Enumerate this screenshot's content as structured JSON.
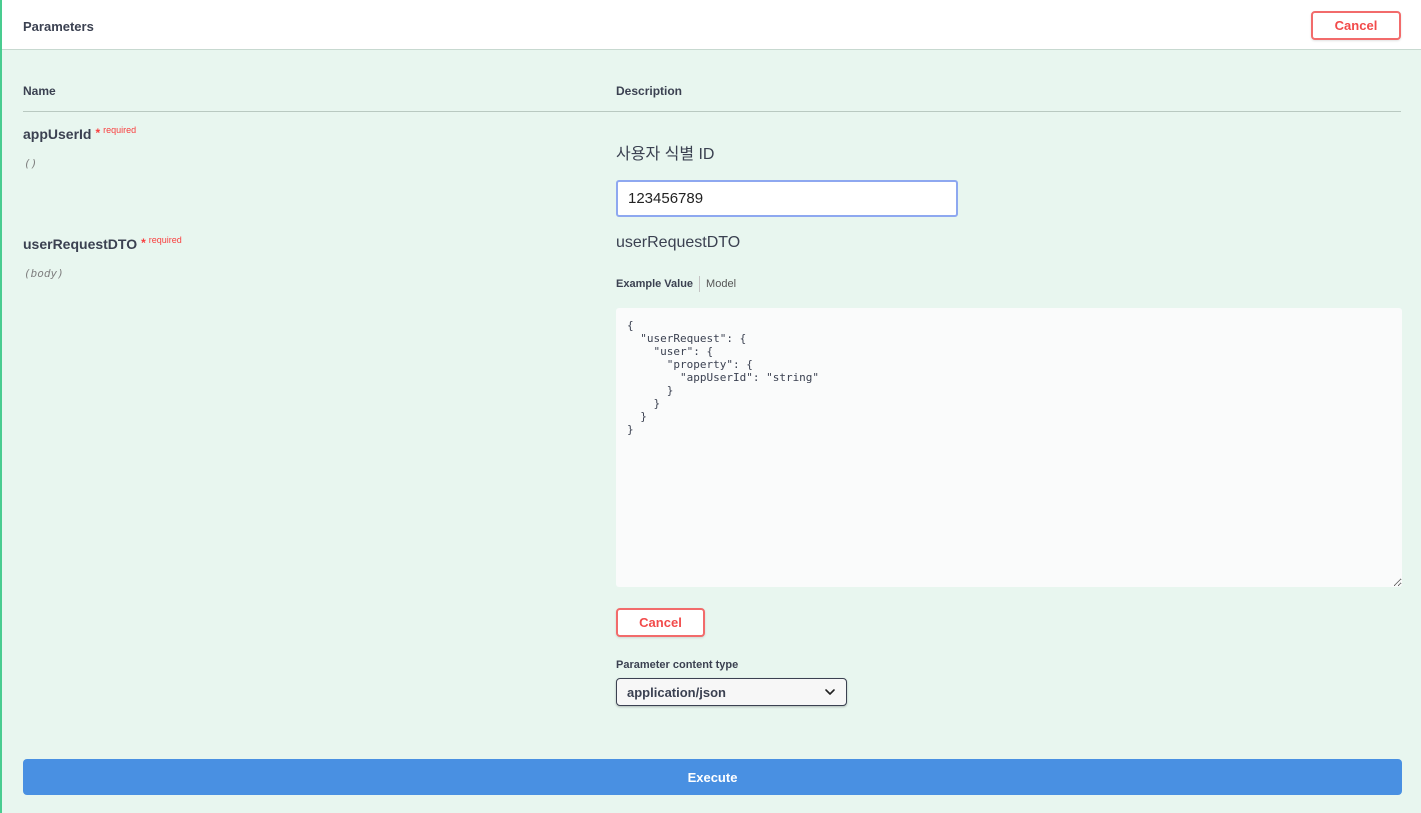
{
  "header": {
    "title": "Parameters",
    "cancel_label": "Cancel"
  },
  "columns": {
    "name": "Name",
    "description": "Description"
  },
  "params": [
    {
      "name": "appUserId",
      "star": "*",
      "required": "required",
      "in": "()",
      "description": "사용자 식별 ID",
      "value": "123456789"
    },
    {
      "name": "userRequestDTO",
      "star": "*",
      "required": "required",
      "in": "(body)",
      "description": "userRequestDTO",
      "tabs": [
        "Example Value",
        "Model"
      ],
      "body_value": "{\n  \"userRequest\": {\n    \"user\": {\n      \"property\": {\n        \"appUserId\": \"string\"\n      }\n    }\n  }\n}",
      "cancel_label": "Cancel",
      "content_type_label": "Parameter content type",
      "content_type_value": "application/json"
    }
  ],
  "execute_label": "Execute",
  "colors": {
    "panel_bg": "#e8f6ef",
    "accent_green": "#49cc90",
    "cancel_red": "#f24a4a",
    "execute_blue": "#4990e2"
  },
  "icons": [
    "chevron-down-icon"
  ]
}
